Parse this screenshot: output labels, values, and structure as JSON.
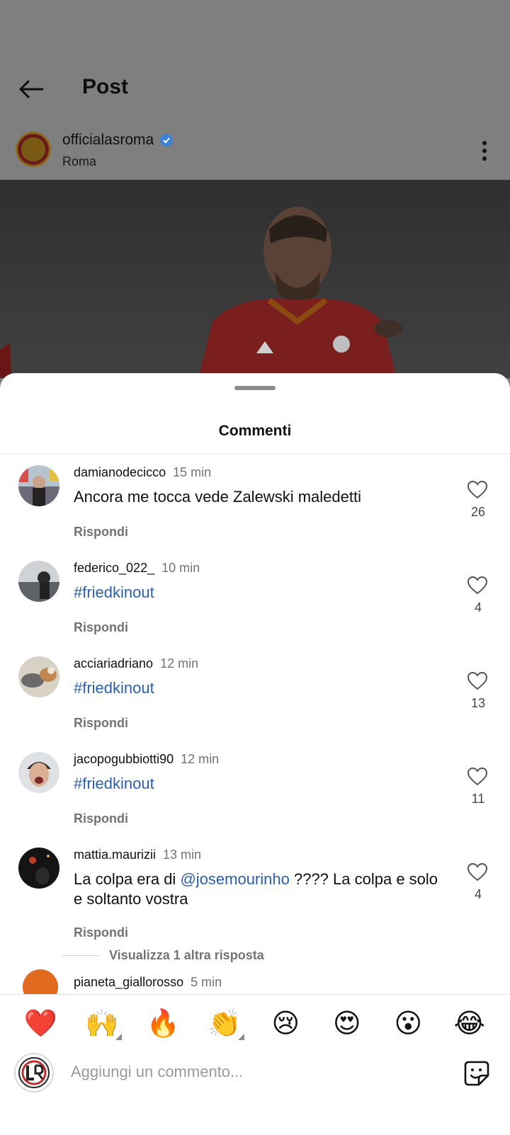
{
  "header": {
    "title": "Post",
    "author": "officialasroma",
    "location": "Roma"
  },
  "sheet": {
    "title": "Commenti"
  },
  "comments": [
    {
      "user": "damianodecicco",
      "time": "15 min",
      "text": "Ancora me tocca vede Zalewski maledetti",
      "reply": "Rispondi",
      "likes": "26"
    },
    {
      "user": "federico_022_",
      "time": "10 min",
      "text": "#friedkinout",
      "reply": "Rispondi",
      "likes": "4"
    },
    {
      "user": "acciariadriano",
      "time": "12 min",
      "text": "#friedkinout",
      "reply": "Rispondi",
      "likes": "13"
    },
    {
      "user": "jacopogubbiotti90",
      "time": "12 min",
      "text": "#friedkinout",
      "reply": "Rispondi",
      "likes": "11"
    },
    {
      "user": "mattia.maurizii",
      "time": "13 min",
      "text_pre": "La colpa era di ",
      "mention": "@josemourinho",
      "text_post": " ???? La colpa e solo e soltanto vostra",
      "reply": "Rispondi",
      "likes": "4"
    }
  ],
  "view_more": "Visualizza 1 altra risposta",
  "partial_comment": {
    "user": "pianeta_giallorosso",
    "time": "5 min"
  },
  "reactions": [
    {
      "name": "heart",
      "glyph": "❤️"
    },
    {
      "name": "raised-hands",
      "glyph": "🙌"
    },
    {
      "name": "fire",
      "glyph": "🔥"
    },
    {
      "name": "clap",
      "glyph": "👏"
    },
    {
      "name": "crying",
      "glyph": "😢"
    },
    {
      "name": "heart-eyes",
      "glyph": "😍"
    },
    {
      "name": "surprised",
      "glyph": "😮"
    },
    {
      "name": "laughing",
      "glyph": "😂"
    }
  ],
  "composer": {
    "placeholder": "Aggiungi un commento..."
  },
  "colors": {
    "link": "#2b5fab",
    "verified": "#3b82d6"
  }
}
